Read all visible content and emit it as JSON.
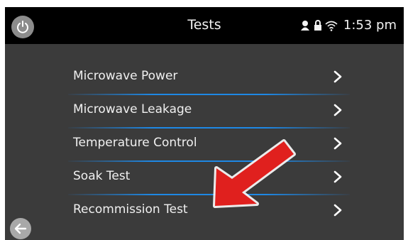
{
  "header": {
    "title": "Tests",
    "time": "1:53 pm",
    "icons": [
      "power-icon",
      "user-icon",
      "lock-icon",
      "wifi-icon"
    ]
  },
  "tests": {
    "items": [
      {
        "label": "Microwave Power"
      },
      {
        "label": "Microwave Leakage"
      },
      {
        "label": "Temperature Control"
      },
      {
        "label": "Soak Test"
      },
      {
        "label": "Recommission Test"
      }
    ]
  },
  "footer": {
    "back_icon": "back-arrow-icon"
  },
  "colors": {
    "screen_bg": "#3b3b3b",
    "header_bg": "#000000",
    "divider": "#1e88e5",
    "annotation_arrow": "#e0201e"
  }
}
